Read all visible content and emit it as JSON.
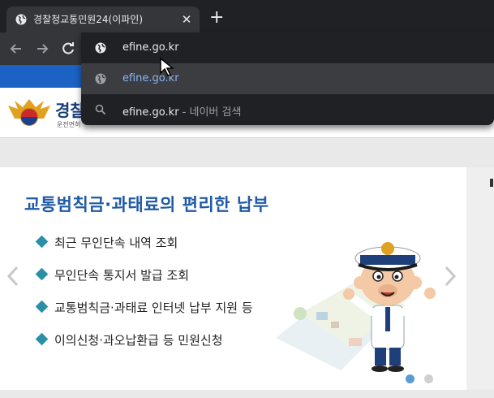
{
  "browser": {
    "tab_title": "경찰청교통민원24(이파인)",
    "new_tab_label": "+",
    "tab_close_label": "✕"
  },
  "omnibox": {
    "input_text": "efine.go.kr",
    "suggestion_url": "efine.go.kr",
    "search_query": "efine.go.kr",
    "search_separator": " - ",
    "search_engine": "네이버 검색"
  },
  "site": {
    "logo_text": "경찰",
    "logo_sub": "운전면허",
    "slide_title": "교통범칙금·과태료의 편리한 납부",
    "bullets": [
      "최근 무인단속 내역 조회",
      "무인단속 통지서 발급 조회",
      "교통범칙금·과태료 인터넷 납부 지원 등",
      "이의신청·과오납환급 등 민원신청"
    ],
    "slide_count": 2,
    "active_slide": 1
  },
  "colors": {
    "browser_dark": "#202124",
    "toolbar": "#35363a",
    "site_blue": "#1b62c4",
    "title_blue": "#1f5aa6",
    "bullet_teal": "#2a8fa8",
    "link_blue": "#8ab4f8"
  }
}
